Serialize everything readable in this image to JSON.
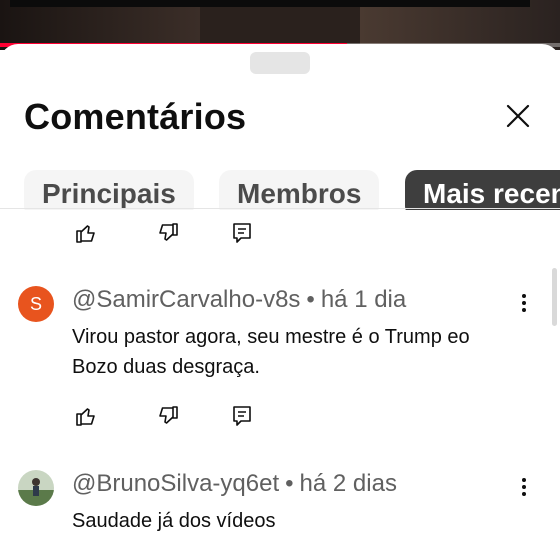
{
  "sheet": {
    "title": "Comentários",
    "video_progress": 0.62
  },
  "tabs": [
    {
      "label": "Principais",
      "selected": false
    },
    {
      "label": "Membros",
      "selected": false
    },
    {
      "label": "Mais recentes",
      "selected": true
    }
  ],
  "comments": [
    {
      "avatar_letter": "S",
      "avatar_color": "#e8541e",
      "author": "@SamirCarvalho-v8s",
      "separator": "•",
      "time": "há 1 dia",
      "text": "Virou pastor agora, seu mestre é o Trump eo Bozo duas desgraça."
    },
    {
      "avatar_letter": "",
      "author": "@BrunoSilva-yq6et",
      "separator": "•",
      "time": "há 2 dias",
      "text": "Saudade já dos vídeos"
    }
  ],
  "icons": {
    "like": "thumbs-up-icon",
    "dislike": "thumbs-down-icon",
    "reply": "reply-comment-icon",
    "more": "more-vertical-icon",
    "close": "close-icon"
  }
}
